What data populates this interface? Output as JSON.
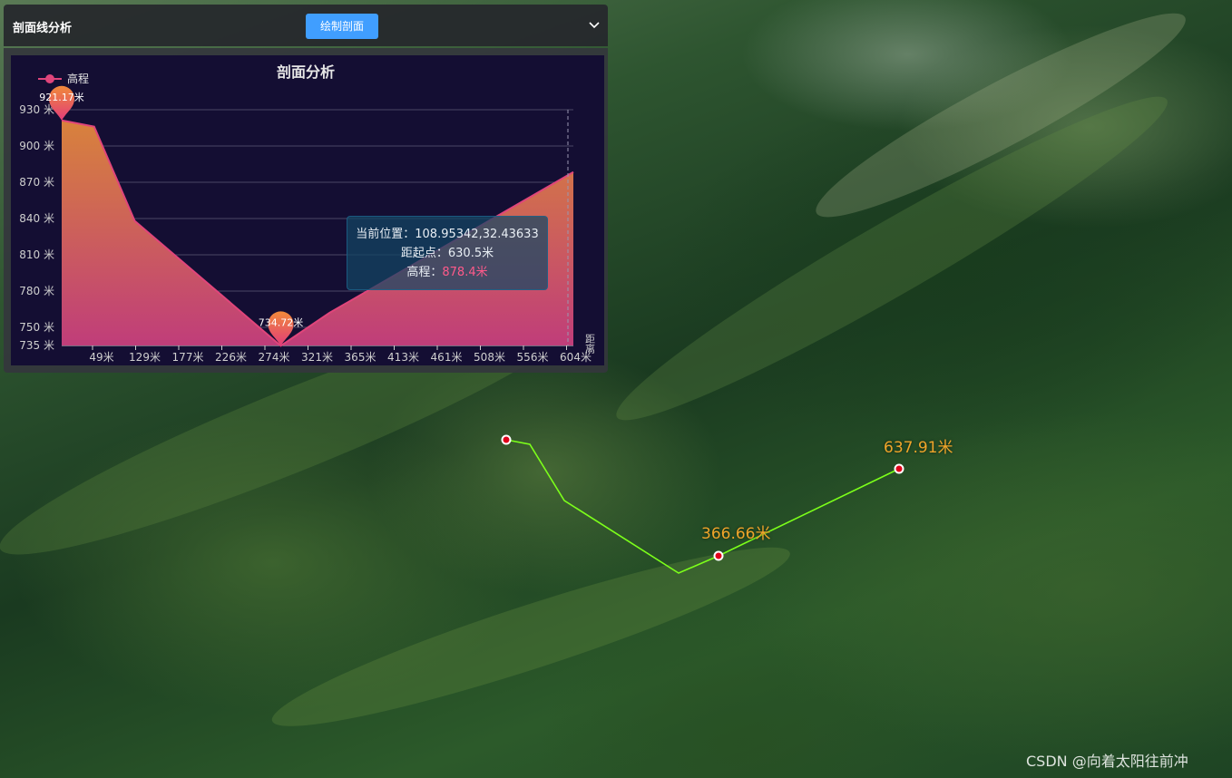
{
  "toolbar": {
    "title": "剖面线分析",
    "draw_button": "绘制剖面"
  },
  "chart_data": {
    "type": "area",
    "title": "剖面分析",
    "legend": [
      "高程"
    ],
    "legend_position": "top-left",
    "xlabel": "距离",
    "ylabel": "",
    "ylim": [
      735,
      930
    ],
    "y_ticks": [
      "735 米",
      "750 米",
      "780 米",
      "810 米",
      "840 米",
      "870 米",
      "900 米",
      "930 米"
    ],
    "y_tick_values": [
      735,
      750,
      780,
      810,
      840,
      870,
      900,
      930
    ],
    "x_ticks": [
      "49米",
      "129米",
      "177米",
      "226米",
      "274米",
      "321米",
      "365米",
      "413米",
      "461米",
      "508米",
      "556米",
      "604米"
    ],
    "grid": true,
    "series": [
      {
        "name": "高程",
        "x": [
          0,
          40,
          90,
          270,
          330,
          630.5
        ],
        "values": [
          921.17,
          916,
          838,
          734.72,
          762,
          878.4
        ]
      }
    ],
    "markers": [
      {
        "label": "921.17米",
        "x": 0,
        "y": 921.17
      },
      {
        "label": "734.72米",
        "x": 270,
        "y": 734.72
      }
    ],
    "colors": {
      "line": "#e0457b",
      "area_top": "#d8823c",
      "area_bottom": "#c03d7a",
      "marker_top": "#f08a3a",
      "marker_bottom": "#e23c7a"
    }
  },
  "tooltip": {
    "position_label": "当前位置：",
    "position_value": "108.95342,32.43633",
    "distance_label": "距起点：",
    "distance_value": "630.5米",
    "elevation_label": "高程：",
    "elevation_value": "878.4米"
  },
  "scene": {
    "label_1": "366.66米",
    "label_2": "637.91米",
    "line_color": "#7cff1a",
    "point_color": "#e0001a"
  },
  "watermark": "CSDN @向着太阳往前冲"
}
